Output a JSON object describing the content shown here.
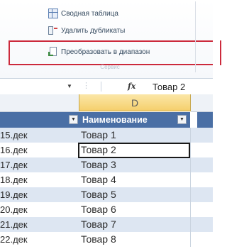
{
  "ribbon": {
    "commands": [
      {
        "label": "Сводная таблица",
        "icon": "pivot-table-icon"
      },
      {
        "label": "Удалить дубликаты",
        "icon": "remove-duplicates-icon"
      },
      {
        "label": "Преобразовать в диапазон",
        "icon": "convert-to-range-icon"
      }
    ],
    "group_label": "Сервис",
    "highlight_color": "#cc2a3c"
  },
  "formula_bar": {
    "fx_label": "fx",
    "value": "Товар 2"
  },
  "columns": {
    "active": "D"
  },
  "table": {
    "header_name": "Наименование",
    "header_color": "#4a6fa5",
    "band_color": "#dde6f2",
    "rows": [
      {
        "date": "15.дек",
        "name": "Товар 1"
      },
      {
        "date": "16.дек",
        "name": "Товар 2"
      },
      {
        "date": "17.дек",
        "name": "Товар 3"
      },
      {
        "date": "18.дек",
        "name": "Товар 4"
      },
      {
        "date": "19.дек",
        "name": "Товар 5"
      },
      {
        "date": "20.дек",
        "name": "Товар 6"
      },
      {
        "date": "21.дек",
        "name": "Товар 7"
      },
      {
        "date": "22.дек",
        "name": "Товар 8"
      }
    ],
    "active_row_index": 1
  }
}
